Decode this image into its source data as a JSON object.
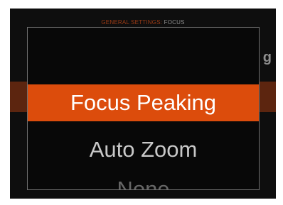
{
  "header": {
    "section": "GENERAL SETTINGS:",
    "current": "FOCUS"
  },
  "background": {
    "setting_label_fragment": "g"
  },
  "menu": {
    "options": [
      {
        "label": "Focus Peaking",
        "selected": true
      },
      {
        "label": "Auto Zoom",
        "selected": false
      },
      {
        "label": "None",
        "selected": false
      }
    ]
  },
  "colors": {
    "accent": "#dc4c0c",
    "header_accent": "#9a3a14",
    "screen_background": "#0e0e0e"
  }
}
